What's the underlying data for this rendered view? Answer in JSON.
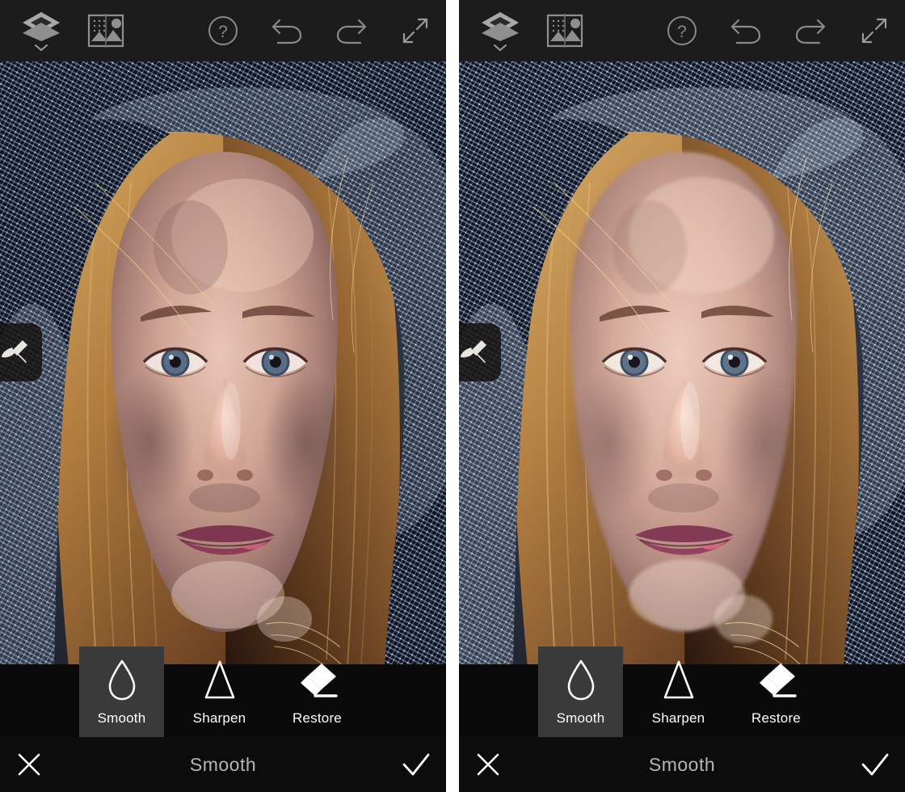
{
  "app": {
    "title": "Smooth",
    "panel_count": 2
  },
  "topbar": {
    "left_items": [
      {
        "name": "layers-icon",
        "label": "Layers"
      },
      {
        "name": "compare-icon",
        "label": "Before / After"
      }
    ],
    "right_items": [
      {
        "name": "help-icon",
        "label": "Help"
      },
      {
        "name": "undo-icon",
        "label": "Undo"
      },
      {
        "name": "redo-icon",
        "label": "Redo"
      },
      {
        "name": "expand-icon",
        "label": "Fit to Screen"
      }
    ],
    "background": "#1c1c1c",
    "icon_color": "#8c8c8c"
  },
  "brush": {
    "name": "brush-icon",
    "label": "Brush Settings",
    "background": "rgba(20,16,14,0.82)"
  },
  "toolstrip": {
    "background": "#0a0a0a",
    "selected_background": "#3a3a3a",
    "selected_index": 0,
    "tools": [
      {
        "label": "Smooth",
        "icon": "droplet-icon",
        "selected": true
      },
      {
        "label": "Sharpen",
        "icon": "triangle-icon",
        "selected": false
      },
      {
        "label": "Restore",
        "icon": "eraser-icon",
        "selected": false
      }
    ]
  },
  "bottombar": {
    "cancel_label": "Cancel",
    "cancel_icon": "close-x-icon",
    "title": "Smooth",
    "confirm_label": "Apply",
    "confirm_icon": "checkmark-icon",
    "background": "#0c0c0c",
    "title_color": "#b6b6b6"
  },
  "photo": {
    "subject": "Portrait of a woman with long strawberry-blonde hair wearing a dark blue woven hooded scarf",
    "colors": {
      "background": "#2b313d",
      "scarf_dark": "#10141f",
      "scarf_highlight": "#c9d8ea",
      "hair_light": "#c99a54",
      "hair_mid": "#8a5c30",
      "hair_dark": "#3a2014",
      "skin_light": "#e7c3b4",
      "skin_mid": "#c49b90",
      "skin_shadow": "#7d5f5c",
      "lip": "#7e3550",
      "lip_highlight": "#d5647f",
      "eye_iris": "#5a6d86",
      "eye_pupil": "#1b1418",
      "brow": "#6b4438"
    },
    "panels": [
      {
        "name": "before-panel",
        "label": "Original",
        "smoothed": false
      },
      {
        "name": "after-panel",
        "label": "Smoothed",
        "smoothed": true
      }
    ]
  }
}
